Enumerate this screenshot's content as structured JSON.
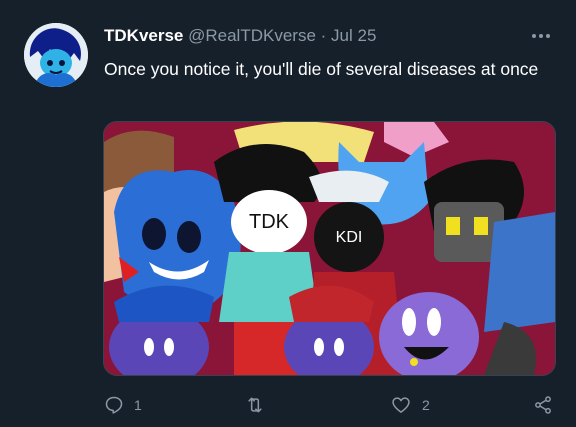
{
  "tweet": {
    "display_name": "TDKverse",
    "handle": "@RealTDKverse",
    "separator": "·",
    "date": "Jul 25",
    "text": "Once you notice it, you'll die of several diseases at once",
    "media_label": "TDK",
    "media_label_2": "KDI"
  },
  "actions": {
    "reply_count": "1",
    "retweet_count": "",
    "like_count": "2"
  },
  "colors": {
    "background": "#15202b",
    "muted": "#8b98a5",
    "text": "#ffffff"
  }
}
